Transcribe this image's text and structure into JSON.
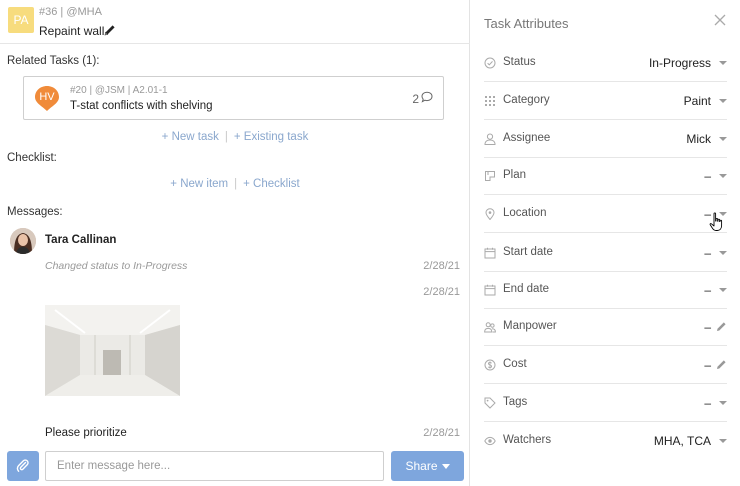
{
  "task": {
    "avatar_initials": "PA",
    "meta": "#36 | @MHA",
    "title": "Repaint wall"
  },
  "related": {
    "label": "Related Tasks (1):",
    "card": {
      "avatar_initials": "HV",
      "avatar_color": "#f08b3a",
      "meta": "#20 | @JSM | A2.01-1",
      "title": "T-stat conflicts with shelving",
      "comment_count": "2"
    },
    "new_task_link": "+ New task",
    "existing_task_link": "+ Existing task",
    "separator": "|"
  },
  "checklist": {
    "label": "Checklist:",
    "new_item_link": "+ New item",
    "checklist_link": "+ Checklist",
    "separator": "|"
  },
  "messages": {
    "label": "Messages:",
    "author": "Tara Callinan",
    "status_change": "Changed status to In-Progress",
    "status_date": "2/28/21",
    "image_date": "2/28/21",
    "text": "Please prioritize",
    "text_date": "2/28/21"
  },
  "composer": {
    "placeholder": "Enter message here...",
    "share_label": "Share"
  },
  "attributes": {
    "title": "Task Attributes",
    "rows": [
      {
        "label": "Status",
        "value": "In-Progress",
        "icon": "status-circle-icon",
        "control": "caret"
      },
      {
        "label": "Category",
        "value": "Paint",
        "icon": "grid-icon",
        "control": "caret"
      },
      {
        "label": "Assignee",
        "value": "Mick",
        "icon": "person-icon",
        "control": "caret"
      },
      {
        "label": "Plan",
        "value": "–",
        "icon": "plan-icon",
        "control": "caret"
      },
      {
        "label": "Location",
        "value": "–",
        "icon": "location-pin-icon",
        "control": "caret"
      },
      {
        "label": "Start date",
        "value": "–",
        "icon": "calendar-icon",
        "control": "caret"
      },
      {
        "label": "End date",
        "value": "–",
        "icon": "calendar-icon",
        "control": "caret"
      },
      {
        "label": "Manpower",
        "value": "–",
        "icon": "people-icon",
        "control": "pencil"
      },
      {
        "label": "Cost",
        "value": "–",
        "icon": "dollar-circle-icon",
        "control": "pencil"
      },
      {
        "label": "Tags",
        "value": "–",
        "icon": "tag-icon",
        "control": "caret"
      },
      {
        "label": "Watchers",
        "value": "MHA, TCA",
        "icon": "eye-icon",
        "control": "caret"
      }
    ]
  },
  "colors": {
    "accent": "#7ea6dd",
    "link": "#8aa7cd",
    "task_avatar": "#f7dc7e"
  }
}
